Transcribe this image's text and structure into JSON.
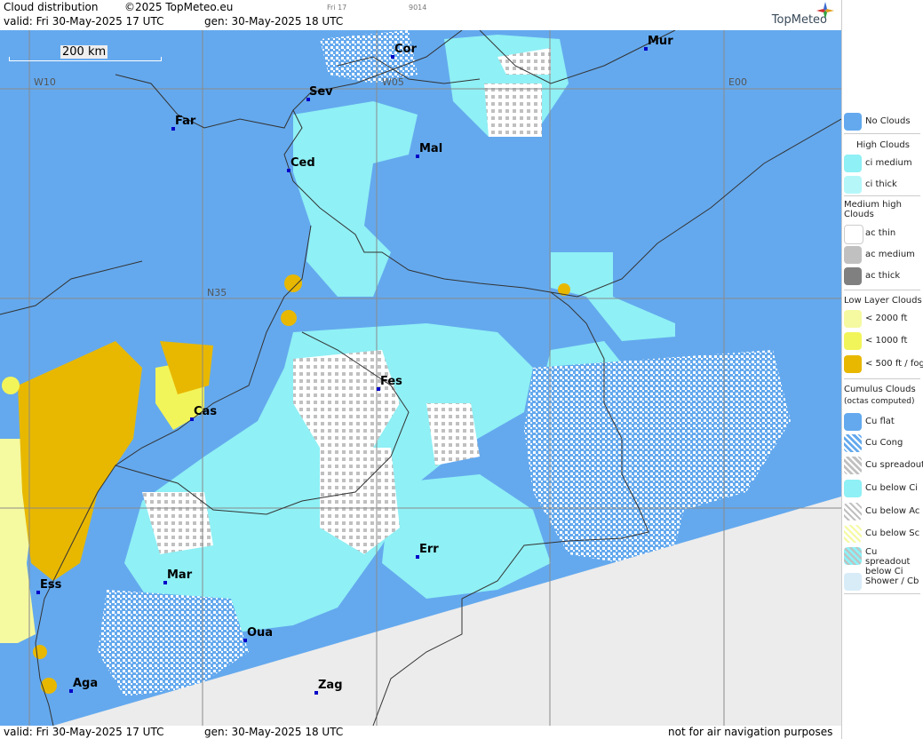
{
  "header": {
    "title": "Cloud distribution",
    "copyright": "©2025 TopMeteo.eu",
    "frame_label": "Fri 17",
    "code": "9014",
    "valid": "valid:  Fri  30-May-2025  17 UTC",
    "gen": "gen: 30-May-2025 18 UTC",
    "logo": "TopMeteo"
  },
  "map": {
    "scale_label": "200 km",
    "grid_labels": {
      "w10": "W10",
      "w05": "W05",
      "e00": "E00",
      "n35": "N35"
    },
    "cities": [
      {
        "name": "Cor"
      },
      {
        "name": "Mur"
      },
      {
        "name": "Sev"
      },
      {
        "name": "Far"
      },
      {
        "name": "Mal"
      },
      {
        "name": "Ced"
      },
      {
        "name": "Fes"
      },
      {
        "name": "Cas"
      },
      {
        "name": "Err"
      },
      {
        "name": "Mar"
      },
      {
        "name": "Ess"
      },
      {
        "name": "Oua"
      },
      {
        "name": "Aga"
      },
      {
        "name": "Zag"
      }
    ]
  },
  "footer": {
    "valid": "valid:  Fri  30-May-2025  17 UTC",
    "gen": "gen: 30-May-2025 18 UTC",
    "note": "not for air navigation purposes"
  },
  "legend": {
    "no_clouds": "No Clouds",
    "high_head": "High Clouds",
    "ci_medium": "ci medium",
    "ci_thick": "ci thick",
    "medium_head": "Medium high Clouds",
    "ac_thin": "ac thin",
    "ac_medium": "ac medium",
    "ac_thick": "ac thick",
    "low_head": "Low Layer Clouds",
    "low_2000": "< 2000 ft",
    "low_1000": "< 1000 ft",
    "low_500": "< 500 ft / fog",
    "cu_head": "Cumulus Clouds",
    "cu_sub": "(octas computed)",
    "cu_flat": "Cu flat",
    "cu_cong": "Cu Cong",
    "cu_spread": "Cu spreadout",
    "cu_below_ci": "Cu below Ci",
    "cu_below_ac": "Cu below Ac",
    "cu_below_sc": "Cu below Sc",
    "cu_spread_ci": "Cu spreadout below Ci",
    "shower": "Shower / Cb",
    "colors": {
      "no_clouds": "#64a9ee",
      "ci": "#8ff0f5",
      "ac_thin": "#ffffff",
      "ac_medium": "#c0c0c0",
      "ac_thick": "#808080",
      "low_2000": "#f5f9a0",
      "low_1000": "#f2f55a",
      "low_500": "#e8b800",
      "outside": "#ececec"
    }
  }
}
